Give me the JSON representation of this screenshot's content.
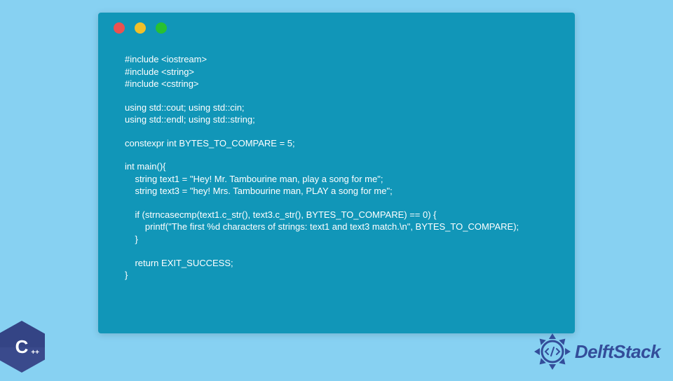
{
  "code": {
    "lines": [
      "#include <iostream>",
      "#include <string>",
      "#include <cstring>",
      "",
      "using std::cout; using std::cin;",
      "using std::endl; using std::string;",
      "",
      "constexpr int BYTES_TO_COMPARE = 5;",
      "",
      "int main(){",
      "    string text1 = \"Hey! Mr. Tambourine man, play a song for me\";",
      "    string text3 = \"hey! Mrs. Tambourine man, PLAY a song for me\";",
      "",
      "    if (strncasecmp(text1.c_str(), text3.c_str(), BYTES_TO_COMPARE) == 0) {",
      "        printf(\"The first %d characters of strings: text1 and text3 match.\\n\", BYTES_TO_COMPARE);",
      "    }",
      "",
      "    return EXIT_SUCCESS;",
      "}"
    ]
  },
  "badges": {
    "cpp_letter": "C",
    "cpp_plus": "++",
    "delft_text": "DelftStack"
  },
  "colors": {
    "page_bg": "#87d1f2",
    "window_bg": "#1196b8",
    "code_text": "#ffffff",
    "dot_red": "#ec5151",
    "dot_yellow": "#f2c029",
    "dot_green": "#28c131",
    "badge_blue": "#3a4a8c",
    "delft_blue": "#334d9a"
  }
}
